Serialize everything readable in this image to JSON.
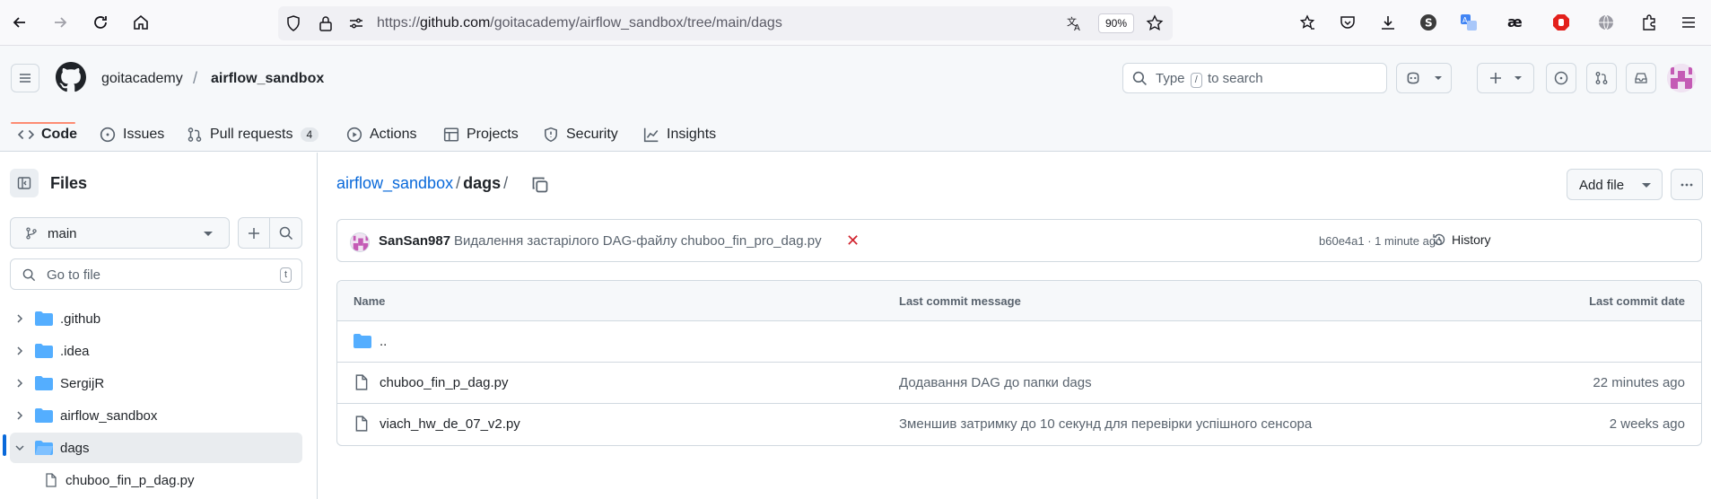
{
  "browser": {
    "url_prefix": "https://",
    "url_host": "github.com",
    "url_path": "/goitacademy/airflow_sandbox/tree/main/dags",
    "zoom": "90%"
  },
  "header": {
    "owner": "goitacademy",
    "slash": "/",
    "repo": "airflow_sandbox",
    "search_type": "Type",
    "search_key": "/",
    "search_rest": "to search"
  },
  "repo_nav": [
    {
      "label": "Code"
    },
    {
      "label": "Issues"
    },
    {
      "label": "Pull requests",
      "count": "4"
    },
    {
      "label": "Actions"
    },
    {
      "label": "Projects"
    },
    {
      "label": "Security"
    },
    {
      "label": "Insights"
    }
  ],
  "sidebar": {
    "title": "Files",
    "branch": "main",
    "goto_placeholder": "Go to file",
    "goto_key": "t",
    "tree": [
      {
        "name": ".github"
      },
      {
        "name": ".idea"
      },
      {
        "name": "SergijR"
      },
      {
        "name": "airflow_sandbox"
      },
      {
        "name": "dags"
      },
      {
        "name": "chuboo_fin_p_dag.py"
      }
    ]
  },
  "main": {
    "path_repo": "airflow_sandbox",
    "path_sep": "/",
    "path_current": "dags",
    "path_trailing": "/",
    "add_file": "Add file",
    "commit": {
      "author": "SanSan987",
      "message": "Видалення застарілого DAG-файлу chuboo_fin_pro_dag.py",
      "status": "✕",
      "meta": "b60e4a1 · 1 minute ago",
      "history": "History"
    },
    "table": {
      "headers": [
        "Name",
        "Last commit message",
        "Last commit date"
      ],
      "rows": [
        {
          "name": "..",
          "message": "",
          "date": ""
        },
        {
          "name": "chuboo_fin_p_dag.py",
          "message": "Додавання DAG до папки dags",
          "date": "22 minutes ago"
        },
        {
          "name": "viach_hw_de_07_v2.py",
          "message": "Зменшив затримку до 10 секунд для перевірки успішного сенсора",
          "date": "2 weeks ago"
        }
      ]
    }
  },
  "colors": {
    "accent": "#0969da",
    "tab_underline": "#fd8c73",
    "folder": "#54aeff",
    "error": "#d1242f"
  }
}
